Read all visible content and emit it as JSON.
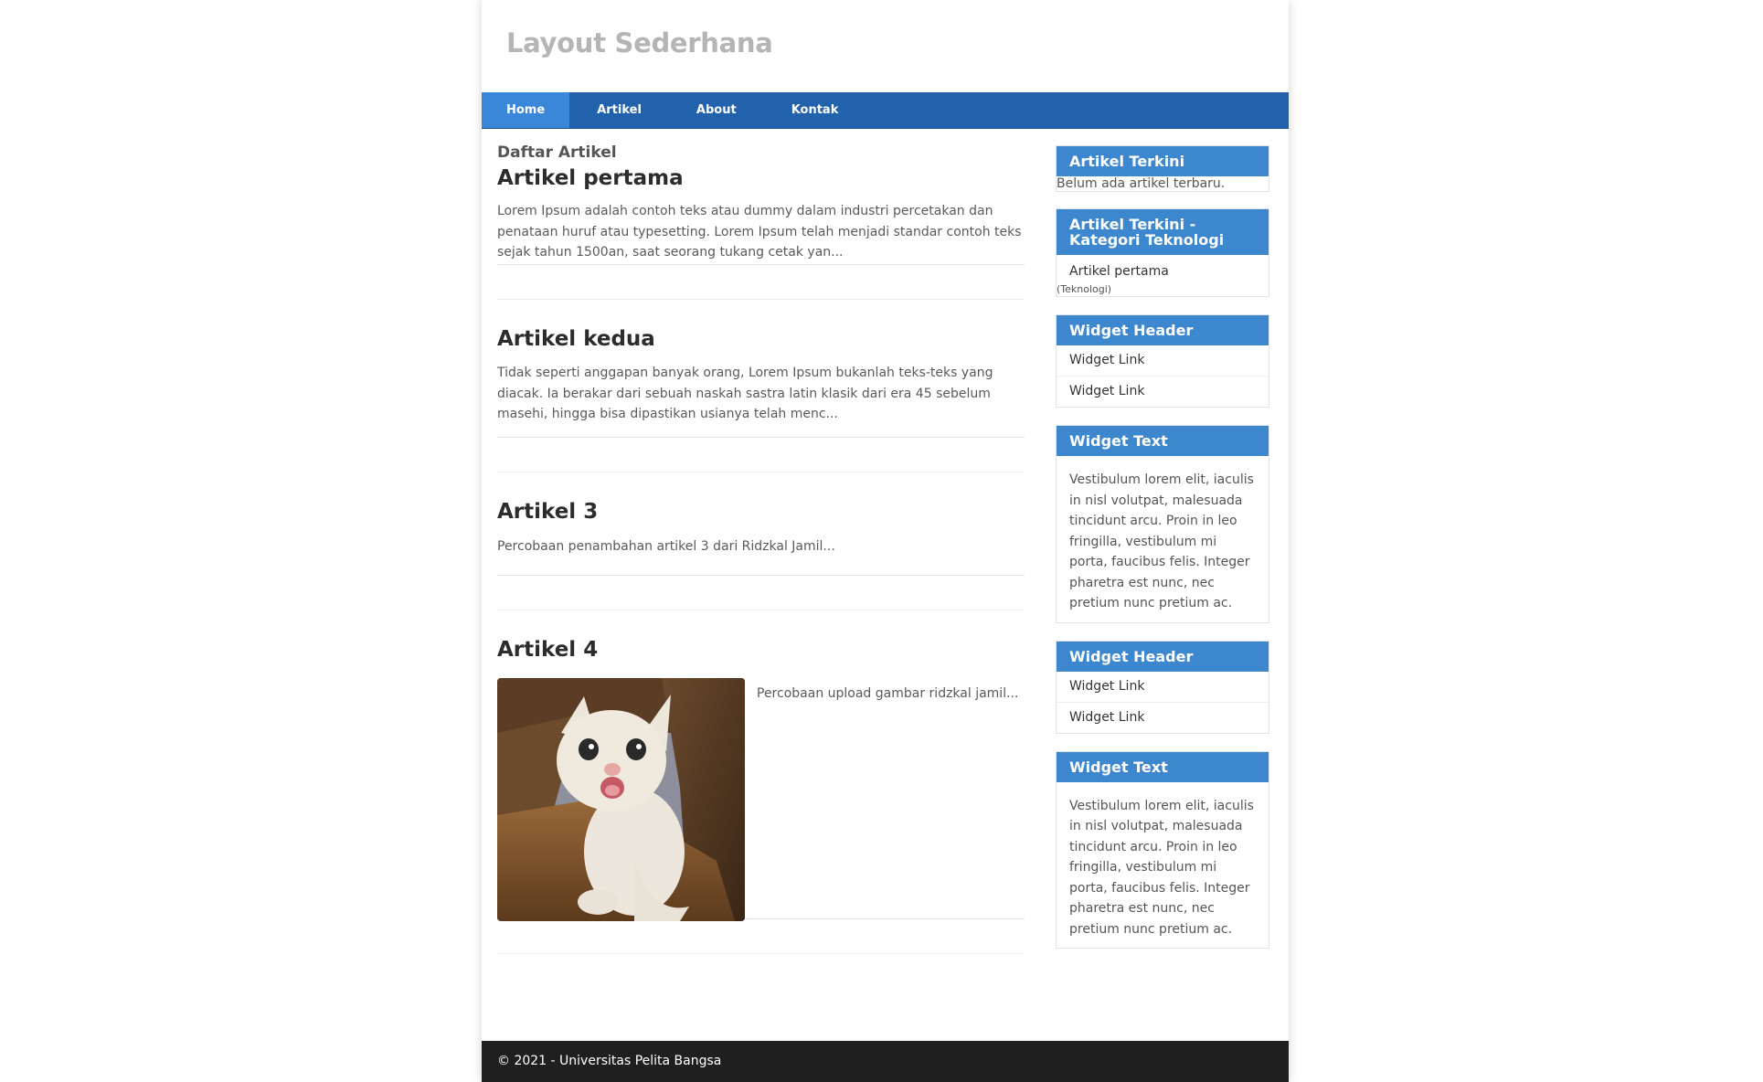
{
  "header": {
    "title": "Layout Sederhana"
  },
  "nav": {
    "items": [
      {
        "label": "Home",
        "active": true
      },
      {
        "label": "Artikel"
      },
      {
        "label": "About"
      },
      {
        "label": "Kontak"
      }
    ]
  },
  "main": {
    "section_title": "Daftar Artikel",
    "articles": [
      {
        "title": "Artikel pertama",
        "excerpt": "Lorem Ipsum adalah contoh teks atau dummy dalam industri percetakan dan penataan huruf atau typesetting. Lorem Ipsum telah menjadi standar contoh teks sejak tahun 1500an, saat seorang tukang cetak yan..."
      },
      {
        "title": "Artikel kedua",
        "excerpt": "Tidak seperti anggapan banyak orang, Lorem Ipsum bukanlah teks-teks yang diacak. Ia berakar dari sebuah naskah sastra latin klasik dari era 45 sebelum masehi, hingga bisa dipastikan usianya telah menc..."
      },
      {
        "title": "Artikel 3",
        "excerpt": "Percobaan penambahan artikel 3 dari Ridzkal Jamil..."
      },
      {
        "title": "Artikel 4",
        "excerpt": "Percobaan upload gambar ridzkal jamil..."
      }
    ]
  },
  "sidebar": {
    "widgets": [
      {
        "header": "Artikel Terkini",
        "body": "Belum ada artikel terbaru."
      },
      {
        "header": "Artikel Terkini - Kategori Teknologi",
        "link": "Artikel pertama",
        "note": "(Teknologi)"
      },
      {
        "header": "Widget Header",
        "links": [
          "Widget Link",
          "Widget Link"
        ]
      },
      {
        "header": "Widget Text",
        "text": "Vestibulum lorem elit, iaculis in nisl volutpat, malesuada tincidunt arcu. Proin in leo fringilla, vestibulum mi porta, faucibus felis. Integer pharetra est nunc, nec pretium nunc pretium ac."
      },
      {
        "header": "Widget Header",
        "links": [
          "Widget Link",
          "Widget Link"
        ]
      },
      {
        "header": "Widget Text",
        "text": "Vestibulum lorem elit, iaculis in nisl volutpat, malesuada tincidunt arcu. Proin in leo fringilla, vestibulum mi porta, faucibus felis. Integer pharetra est nunc, nec pretium nunc pretium ac."
      }
    ]
  },
  "footer": {
    "text": "© 2021 - Universitas Pelita Bangsa"
  },
  "colors": {
    "nav_bg": "#2262ad",
    "nav_active": "#3a86d8",
    "widget_header": "#3d87cf",
    "footer_bg": "#1f1f1f"
  }
}
